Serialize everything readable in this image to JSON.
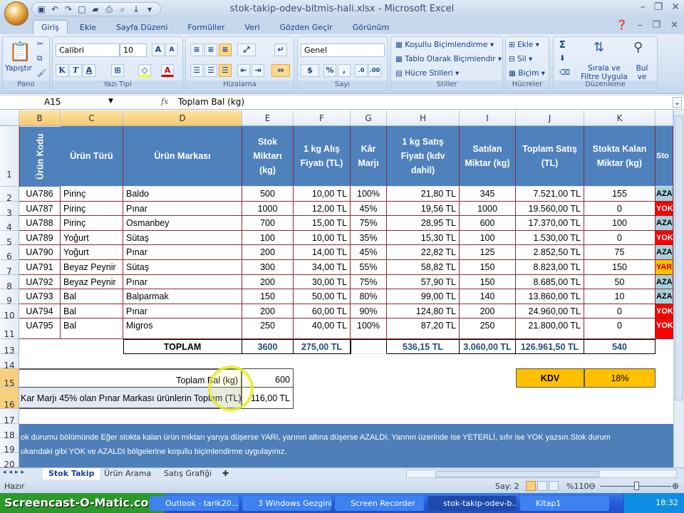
{
  "window": {
    "title": "stok-takip-odev-bitmis-hali.xlsx - Microsoft Excel"
  },
  "ribbon": {
    "tabs": [
      "Giriş",
      "Ekle",
      "Sayfa Düzeni",
      "Formüller",
      "Veri",
      "Gözden Geçir",
      "Görünüm"
    ],
    "active_tab": "Giriş",
    "groups": {
      "pano": "Pano",
      "yazi_tipi": "Yazı Tipi",
      "hizalama": "Hizalama",
      "sayi": "Sayı",
      "stiller": "Stiller",
      "hucreler": "Hücreler",
      "duzenleme": "Düzenleme"
    },
    "paste": "Yapıştır",
    "font_name": "Calibri",
    "font_size": "10",
    "bold": "K",
    "italic": "T",
    "underline": "A",
    "number_format": "Genel",
    "percent": "%",
    "comma": ",",
    "cond_format": "Koşullu Biçimlendirme",
    "table_format": "Tablo Olarak Biçimlendir",
    "cell_styles": "Hücre Stilleri",
    "insert": "Ekle",
    "delete": "Sil",
    "format": "Biçim",
    "sum": "Σ",
    "sort_filter": "Sırala ve Filtre Uygula",
    "find_select": "Bul ve Seç"
  },
  "formula_bar": {
    "name_box": "A15",
    "fx": "fx",
    "content": "Toplam Bal (kg)"
  },
  "columns": [
    "B",
    "C",
    "D",
    "E",
    "F",
    "G",
    "H",
    "I",
    "J",
    "K",
    ""
  ],
  "headers": [
    "Ürün Kodu",
    "Ürün Türü",
    "Ürün Markası",
    "Stok Miktarı (kg)",
    "1 kg Alış Fiyatı (TL)",
    "Kâr Marjı",
    "1 kg Satış Fiyatı (kdv dahil)",
    "Satılan Miktar (kg)",
    "Toplam Satış (TL)",
    "Stokta Kalan Miktar (kg)",
    "Sto"
  ],
  "rows": [
    [
      "UA786",
      "Pirinç",
      "Baldo",
      "500",
      "10,00 TL",
      "100%",
      "21,80 TL",
      "345",
      "7.521,00 TL",
      "155",
      "AZA"
    ],
    [
      "UA787",
      "Pirinç",
      "Pınar",
      "1000",
      "12,00 TL",
      "45%",
      "19,56 TL",
      "1000",
      "19.560,00 TL",
      "0",
      "YOK"
    ],
    [
      "UA788",
      "Pirinç",
      "Osmanbey",
      "700",
      "15,00 TL",
      "75%",
      "28,95 TL",
      "600",
      "17.370,00 TL",
      "100",
      "AZA"
    ],
    [
      "UA789",
      "Yoğurt",
      "Sütaş",
      "100",
      "10,00 TL",
      "35%",
      "15,30 TL",
      "100",
      "1.530,00 TL",
      "0",
      "YOK"
    ],
    [
      "UA790",
      "Yoğurt",
      "Pınar",
      "200",
      "14,00 TL",
      "45%",
      "22,82 TL",
      "125",
      "2.852,50 TL",
      "75",
      "AZA"
    ],
    [
      "UA791",
      "Beyaz Peynir",
      "Sütaş",
      "300",
      "34,00 TL",
      "55%",
      "58,82 TL",
      "150",
      "8.823,00 TL",
      "150",
      "YAR"
    ],
    [
      "UA792",
      "Beyaz Peynir",
      "Pınar",
      "200",
      "30,00 TL",
      "75%",
      "57,90 TL",
      "150",
      "8.685,00 TL",
      "50",
      "AZA"
    ],
    [
      "UA793",
      "Bal",
      "Balparmak",
      "150",
      "50,00 TL",
      "80%",
      "99,00 TL",
      "140",
      "13.860,00 TL",
      "10",
      "AZA"
    ],
    [
      "UA794",
      "Bal",
      "Pınar",
      "200",
      "60,00 TL",
      "90%",
      "124,80 TL",
      "200",
      "24.960,00 TL",
      "0",
      "YOK"
    ],
    [
      "UA795",
      "Bal",
      "Migros",
      "250",
      "40,00 TL",
      "100%",
      "87,20 TL",
      "250",
      "21.800,00 TL",
      "0",
      "YOK"
    ]
  ],
  "status_colors": {
    "AZA": "#a9cfd9",
    "YOK": "#ff0000",
    "YAR": "#ffc000"
  },
  "totals": {
    "label": "TOPLAM",
    "stock": "3600",
    "buy": "275,00 TL",
    "sell": "536,15 TL",
    "sold": "3.060,00 TL",
    "total_sales": "126.961,50 TL",
    "remaining": "540"
  },
  "summary": {
    "bal_label": "Toplam Bal (kg)",
    "bal_value": "600",
    "pinar_label": "Kar Marjı 45% olan Pınar Markası ürünlerin Toplam (TL)",
    "pinar_value": "116,00 TL",
    "kdv_label": "KDV",
    "kdv_value": "18%"
  },
  "row_numbers": [
    "1",
    "2",
    "3",
    "4",
    "5",
    "6",
    "7",
    "8",
    "9",
    "10",
    "11",
    "13",
    "14",
    "15",
    "16",
    "17",
    "18",
    "19",
    "20"
  ],
  "note": {
    "line1": "ok durumu bölümünde Eğer stokta kalan ürün miktarı yarıya düşerse YARI, yarının altına düşerse AZALDI, Yarının üzerinde ise YETERLİ,  sıfır ise YOK yazsın.Stok durum",
    "line2": "ukarıdaki gibi YOK ve AZALDI bölgelerine koşullu biçimlendirme uygulayınız."
  },
  "sheets": [
    "Stok Takip",
    "Ürün Arama",
    "Satış Grafiği"
  ],
  "status_bar": {
    "ready": "Hazır",
    "count": "Say: 2",
    "zoom": "%110"
  },
  "taskbar": {
    "watermark": "Screencast-O-Matic.com",
    "items": [
      "Outlook - tarik20...",
      "3 Windows Gezgini",
      "Screen Recorder",
      "stok-takip-odev-b...",
      "Kitap1"
    ],
    "clock": "18:32"
  }
}
